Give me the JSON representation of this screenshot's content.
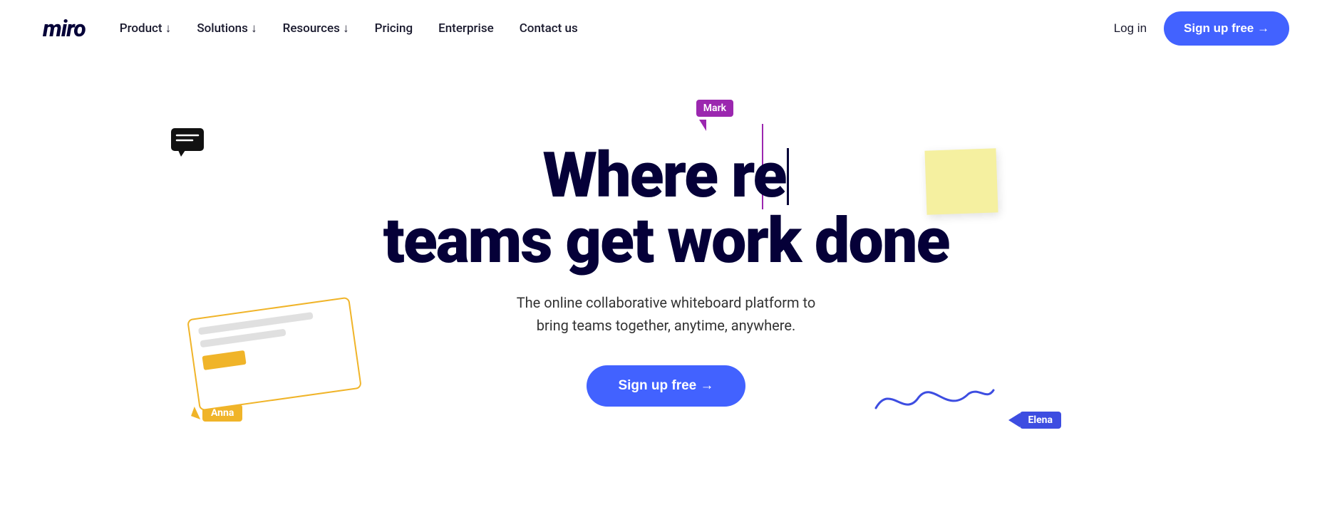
{
  "brand": {
    "logo": "miro"
  },
  "nav": {
    "links": [
      {
        "label": "Product ↓",
        "id": "product"
      },
      {
        "label": "Solutions ↓",
        "id": "solutions"
      },
      {
        "label": "Resources ↓",
        "id": "resources"
      },
      {
        "label": "Pricing",
        "id": "pricing"
      },
      {
        "label": "Enterprise",
        "id": "enterprise"
      },
      {
        "label": "Contact us",
        "id": "contact"
      }
    ],
    "login_label": "Log in",
    "signup_label": "Sign up free →"
  },
  "hero": {
    "title_line1": "Where re",
    "title_line2": "teams get work done",
    "subtitle_line1": "The online collaborative whiteboard platform to",
    "subtitle_line2": "bring teams together, anytime, anywhere.",
    "cta_label": "Sign up free →"
  },
  "decorations": {
    "mark_label": "Mark",
    "anna_label": "Anna",
    "elena_label": "Elena"
  },
  "colors": {
    "primary": "#4262ff",
    "dark": "#050038",
    "mark_color": "#9b27af",
    "anna_color": "#f0b429",
    "elena_color": "#3d4de1"
  }
}
